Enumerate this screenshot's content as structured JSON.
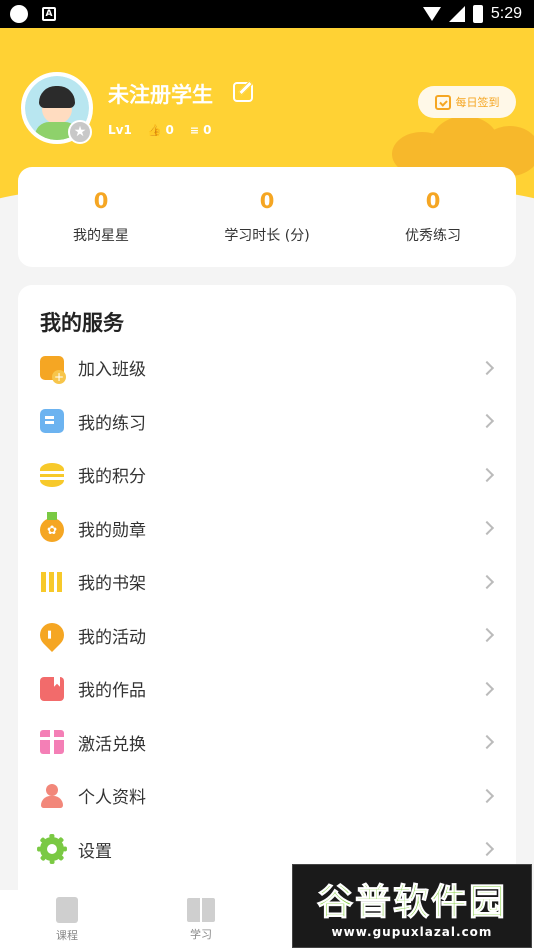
{
  "status_bar": {
    "time": "5:29",
    "notif_letter": "A"
  },
  "profile": {
    "name": "未注册学生",
    "level": "Lv1",
    "likes": "0",
    "coins": "0",
    "checkin_label": "每日签到"
  },
  "stats": [
    {
      "value": "0",
      "label": "我的星星"
    },
    {
      "value": "0",
      "label": "学习时长 (分)"
    },
    {
      "value": "0",
      "label": "优秀练习"
    }
  ],
  "services": {
    "title": "我的服务",
    "items": [
      {
        "label": "加入班级",
        "icon": "join-class-icon"
      },
      {
        "label": "我的练习",
        "icon": "practice-icon"
      },
      {
        "label": "我的积分",
        "icon": "points-icon"
      },
      {
        "label": "我的勋章",
        "icon": "medal-icon"
      },
      {
        "label": "我的书架",
        "icon": "bookshelf-icon"
      },
      {
        "label": "我的活动",
        "icon": "activity-icon"
      },
      {
        "label": "我的作品",
        "icon": "works-icon"
      },
      {
        "label": "激活兑换",
        "icon": "gift-icon"
      },
      {
        "label": "个人资料",
        "icon": "profile-icon"
      },
      {
        "label": "设置",
        "icon": "settings-icon"
      }
    ]
  },
  "bottom_nav": [
    {
      "label": "课程"
    },
    {
      "label": "学习"
    }
  ],
  "watermark": {
    "main": "谷普软件园",
    "url": "www.gupuxlazal.com"
  },
  "colors": {
    "header": "#ffd234",
    "accent": "#f5a623"
  }
}
